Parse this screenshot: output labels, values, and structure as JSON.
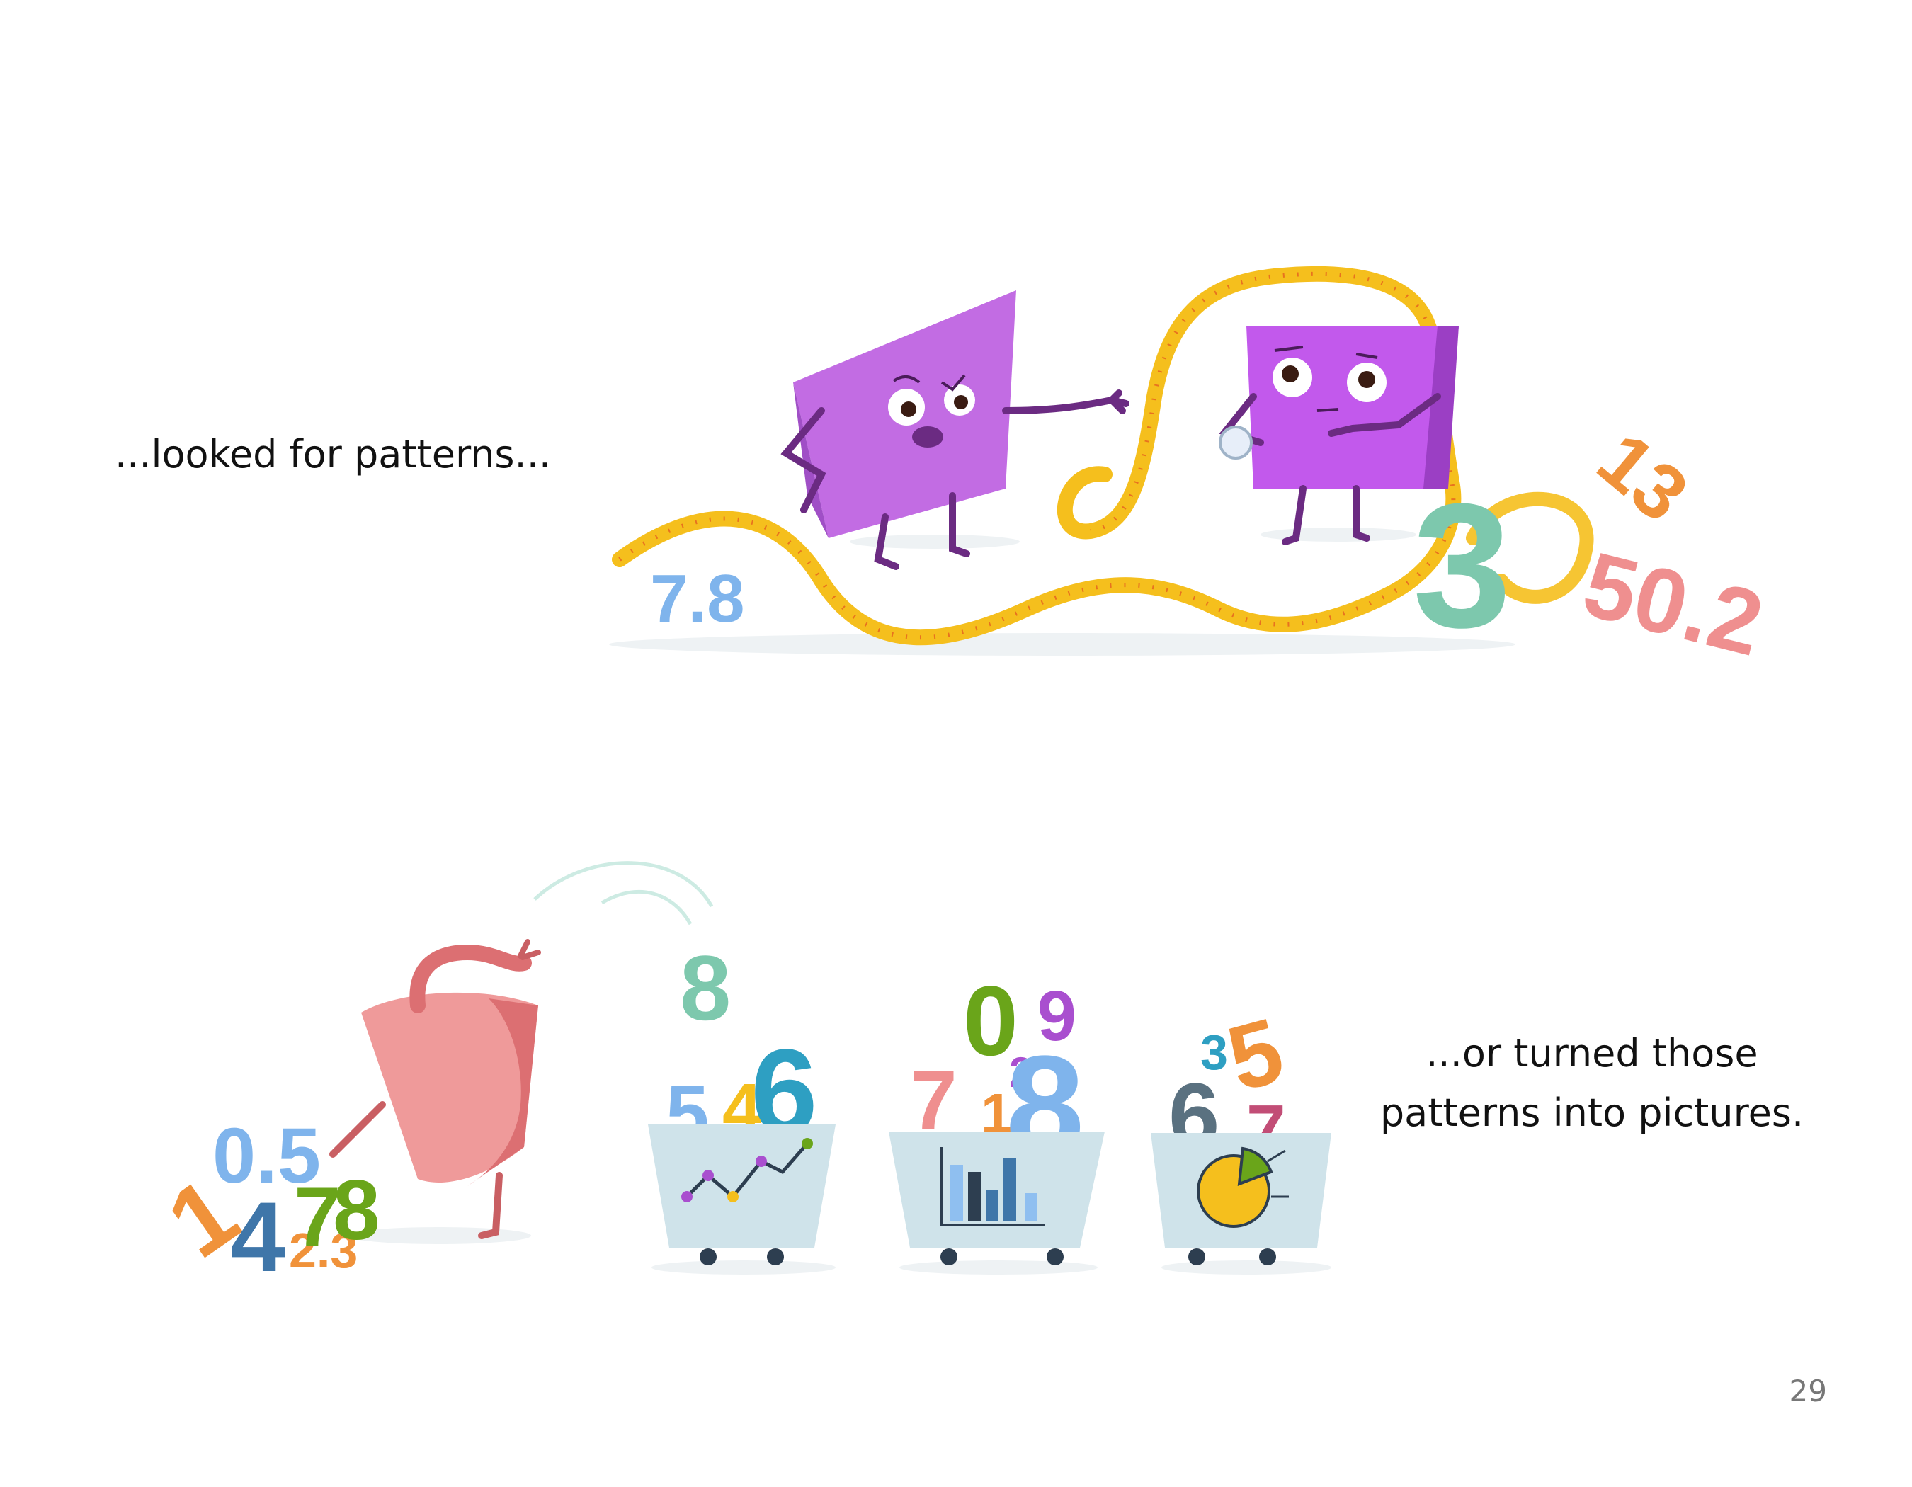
{
  "page": {
    "caption_top": "...looked for patterns...",
    "caption_bottom": [
      "...or turned those",
      "patterns into pictures."
    ],
    "page_number": "29"
  },
  "illustration": {
    "top_scene": {
      "numbers": [
        "7.8",
        "3",
        "13",
        "50.2"
      ],
      "characters": [
        "purple-square-pointing",
        "purple-square-with-magnifier",
        "measuring-tape"
      ]
    },
    "bottom_scene": {
      "pile_numbers": [
        "0.5",
        "1",
        "4",
        "2.3",
        "7",
        "8"
      ],
      "jumping_number": "8",
      "carts": [
        {
          "chart_icon": "line-chart-icon",
          "numbers": [
            "5",
            "4",
            "6"
          ]
        },
        {
          "chart_icon": "bar-chart-icon",
          "numbers": [
            "0",
            "6",
            "2",
            "7",
            "1",
            "8"
          ]
        },
        {
          "chart_icon": "pie-chart-icon",
          "numbers": [
            "3",
            "5",
            "6",
            "7"
          ]
        }
      ]
    },
    "colors": {
      "purple": "#c26ce3",
      "purple_dark": "#7b2d8e",
      "tape": "#f5bf1d",
      "teal": "#7dc8ad",
      "orange": "#f0923a",
      "pink": "#ef8f8f",
      "blue_light": "#7fb4ec",
      "blue_dark": "#3f76a9",
      "green": "#6aa51a",
      "cart": "#cfe3ea"
    }
  }
}
